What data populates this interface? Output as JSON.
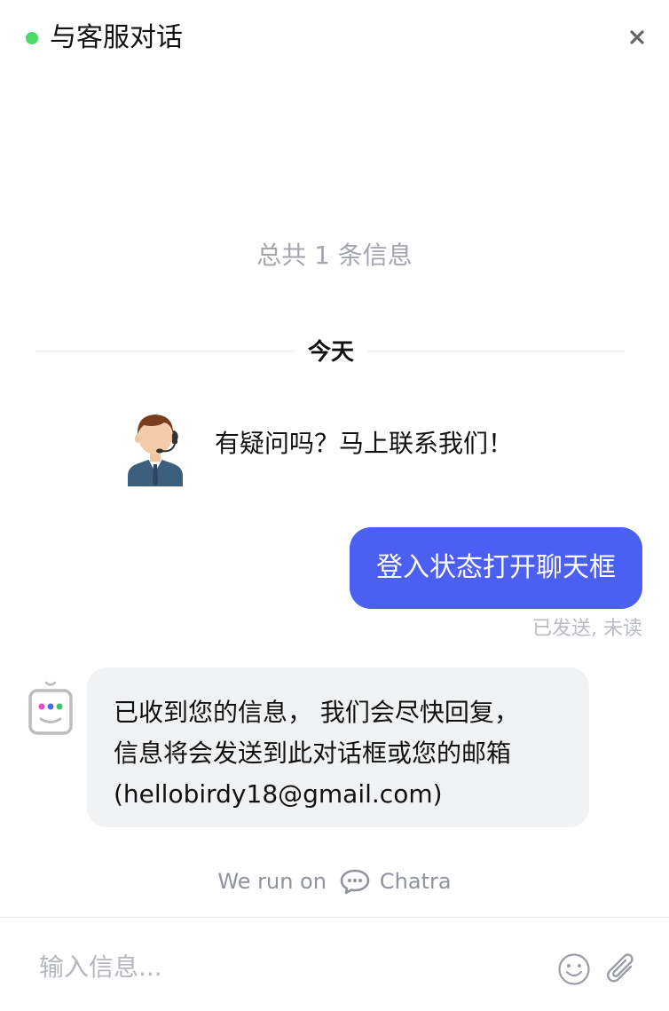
{
  "header": {
    "title": "与客服对话",
    "status_color": "#4cd964",
    "close_icon": "close-icon"
  },
  "thread": {
    "message_count": "总共 1 条信息",
    "date_divider": "今天"
  },
  "messages": {
    "agent": {
      "avatar_icon": "support-agent-avatar",
      "text": "有疑问吗？马上联系我们！"
    },
    "outgoing": {
      "text": "登入状态打开聊天框",
      "status": "已发送, 未读",
      "bubble_color": "#4b5ff2"
    },
    "bot": {
      "avatar_icon": "bot-avatar",
      "lines": [
        "已收到您的信息， 我们会尽快回复，",
        "信息将会发送到此对话框或您的邮箱",
        "(hellobirdy18@gmail.com)"
      ]
    }
  },
  "branding": {
    "prefix": "We run on",
    "icon": "chat-bubble-icon",
    "name": "Chatra"
  },
  "composer": {
    "placeholder": "输入信息...",
    "value": "",
    "emoji_icon": "smiley-icon",
    "attach_icon": "paperclip-icon"
  }
}
